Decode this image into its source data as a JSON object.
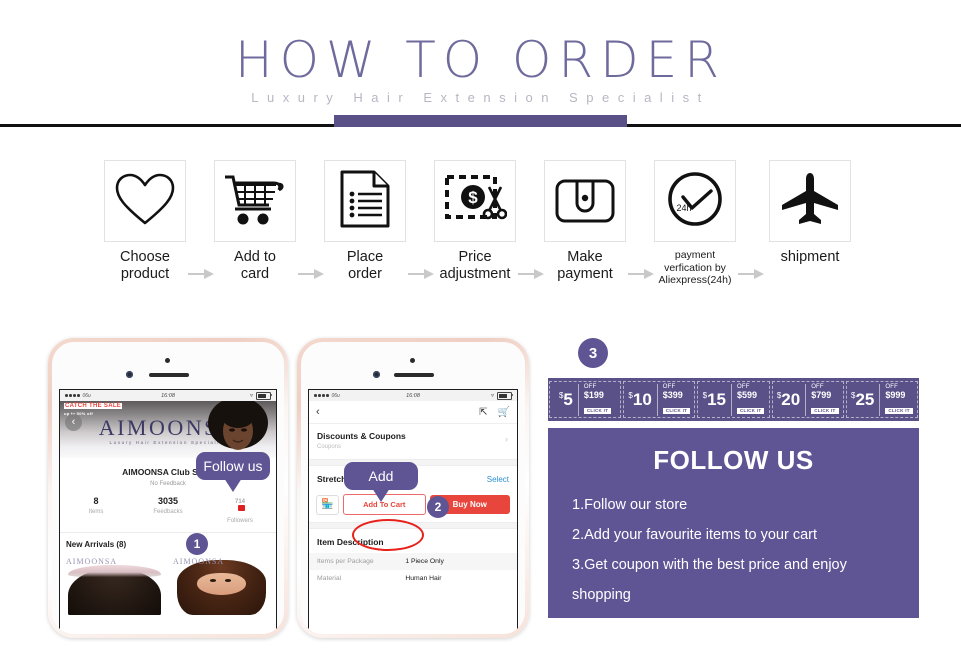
{
  "header": {
    "title": "HOW TO ORDER",
    "subtitle": "Luxury Hair Extension Specialist"
  },
  "steps": [
    {
      "icon": "heart-icon",
      "line1": "Choose",
      "line2": "product"
    },
    {
      "icon": "cart-icon",
      "line1": "Add to",
      "line2": "card"
    },
    {
      "icon": "document-icon",
      "line1": "Place",
      "line2": "order"
    },
    {
      "icon": "price-tag-scissors-icon",
      "line1": "Price",
      "line2": "adjustment"
    },
    {
      "icon": "wallet-icon",
      "line1": "Make",
      "line2": "payment"
    },
    {
      "icon": "clock-check-24h-icon",
      "line1": "payment",
      "line2": "verfication by",
      "line3": "Aliexpress(24h)",
      "small": true
    },
    {
      "icon": "airplane-icon",
      "line1": "shipment",
      "line2": ""
    }
  ],
  "clock_icon_label": "24h",
  "phone1": {
    "status": {
      "carrier": "06u",
      "time": "16:08"
    },
    "sale_tag_line1": "CATCH THE SALE",
    "sale_tag_line2": "up to 50% off",
    "brand": "AIMOONSA",
    "brand_sub": "Luxury Hair Extension Specialist",
    "store_name": "AIMOONSA Club Store",
    "feedback": "No Feedback",
    "stats": [
      {
        "value": "8",
        "label": "Items"
      },
      {
        "value": "3035",
        "label": "Feedbacks"
      },
      {
        "value": "714",
        "label": "Followers",
        "flag": true
      }
    ],
    "new_arrivals": "New Arrivals (8)",
    "watermark": "AIMOONSA",
    "bubble": "Follow us",
    "badge": "1"
  },
  "phone2": {
    "status": {
      "carrier": "06u",
      "time": "16:08"
    },
    "coupons_title": "Discounts & Coupons",
    "coupons_sub": "Coupons",
    "length_title": "Stretched Length",
    "select_label": "Select",
    "add_to_cart": "Add To Cart",
    "buy_now": "Buy Now",
    "desc_title": "Item Description",
    "desc_rows": [
      {
        "key": "Items per Package",
        "value": "1 Piece Only"
      },
      {
        "key": "Material",
        "value": "Human Hair"
      }
    ],
    "bubble": "Add",
    "badge": "2"
  },
  "right": {
    "badge": "3",
    "coupons": [
      {
        "amount": "5",
        "off": "OFF",
        "min": "$199",
        "cta": "CLICK IT"
      },
      {
        "amount": "10",
        "off": "OFF",
        "min": "$399",
        "cta": "CLICK IT"
      },
      {
        "amount": "15",
        "off": "OFF",
        "min": "$599",
        "cta": "CLICK IT"
      },
      {
        "amount": "20",
        "off": "OFF",
        "min": "$799",
        "cta": "CLICK IT"
      },
      {
        "amount": "25",
        "off": "OFF",
        "min": "$999",
        "cta": "CLICK IT"
      }
    ],
    "currency": "$",
    "panel_title": "FOLLOW US",
    "panel_items": [
      "1.Follow our store",
      "2.Add your favourite items to your cart",
      "3.Get coupon with the best price and enjoy",
      "shopping"
    ]
  },
  "colors": {
    "purple": "#5f5494",
    "purple_dark": "#5b5189",
    "title_purple": "#6e6a9c",
    "subtitle_gray": "#b9b5c4",
    "red": "#e8453c",
    "blue_link": "#2f8fd6"
  }
}
